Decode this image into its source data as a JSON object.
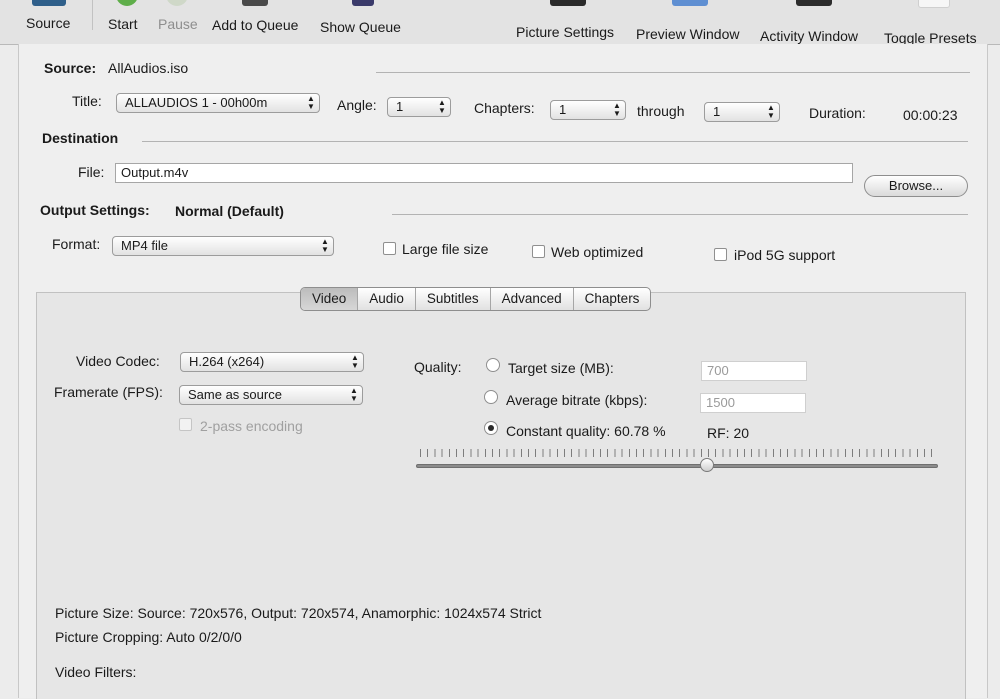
{
  "toolbar": {
    "source": "Source",
    "start": "Start",
    "pause": "Pause",
    "add_to_queue": "Add to Queue",
    "show_queue": "Show Queue",
    "picture_settings": "Picture Settings",
    "preview_window": "Preview Window",
    "activity_window": "Activity Window",
    "toggle_presets": "Toggle Presets"
  },
  "source": {
    "label": "Source:",
    "value": "AllAudios.iso",
    "title_label": "Title:",
    "title_value": "ALLAUDIOS 1 - 00h00m",
    "angle_label": "Angle:",
    "angle_value": "1",
    "chapters_label": "Chapters:",
    "chapters_from": "1",
    "through_label": "through",
    "chapters_to": "1",
    "duration_label": "Duration:",
    "duration_value": "00:00:23"
  },
  "destination": {
    "heading": "Destination",
    "file_label": "File:",
    "file_value": "Output.m4v",
    "browse": "Browse..."
  },
  "output": {
    "heading": "Output Settings:",
    "preset": "Normal (Default)",
    "format_label": "Format:",
    "format_value": "MP4 file",
    "large_file": "Large file size",
    "web_optimized": "Web optimized",
    "ipod": "iPod 5G support"
  },
  "tabs": [
    "Video",
    "Audio",
    "Subtitles",
    "Advanced",
    "Chapters"
  ],
  "video": {
    "codec_label": "Video Codec:",
    "codec_value": "H.264 (x264)",
    "framerate_label": "Framerate (FPS):",
    "framerate_value": "Same as source",
    "twopass": "2-pass encoding",
    "quality_label": "Quality:",
    "target_size_label": "Target size (MB):",
    "target_size_value": "700",
    "avg_bitrate_label": "Average bitrate (kbps):",
    "avg_bitrate_value": "1500",
    "constant_quality_label": "Constant quality: 60.78 %",
    "rf_label": "RF: 20",
    "quality_slider_value": 0.6078
  },
  "info": {
    "picture_size": "Picture Size: Source: 720x576, Output: 720x574, Anamorphic: 1024x574 Strict",
    "picture_cropping": "Picture Cropping: Auto 0/2/0/0",
    "video_filters": "Video Filters:"
  }
}
